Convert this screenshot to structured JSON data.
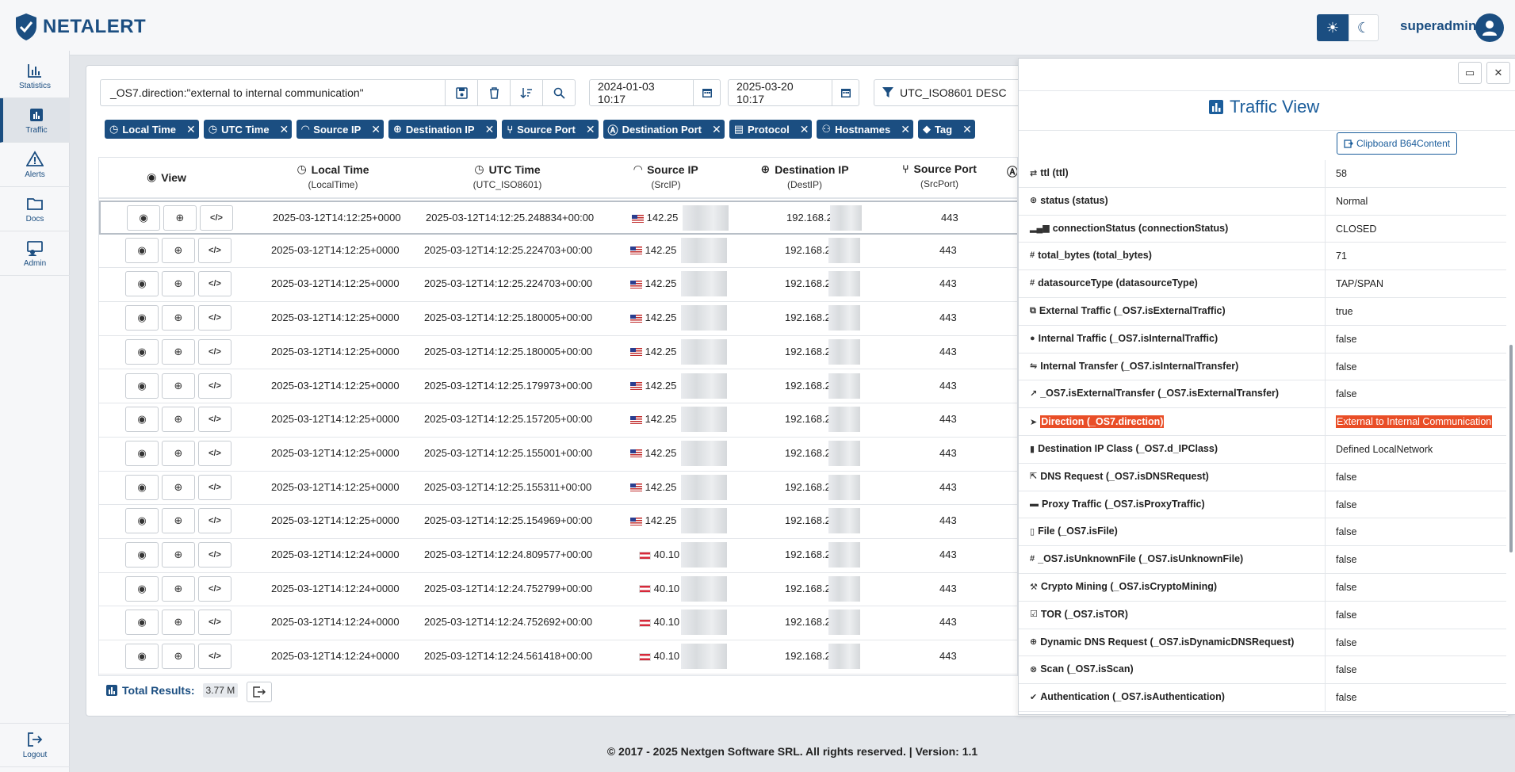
{
  "header": {
    "logo_text": "NETALERT",
    "username": "superadmin"
  },
  "sidebar": {
    "items": [
      {
        "label": "Statistics",
        "icon": "chart-icon"
      },
      {
        "label": "Traffic",
        "icon": "traffic-chart-icon"
      },
      {
        "label": "Alerts",
        "icon": "warning-icon"
      },
      {
        "label": "Docs",
        "icon": "folder-icon"
      },
      {
        "label": "Admin",
        "icon": "admin-icon"
      }
    ],
    "logout_label": "Logout"
  },
  "toolbar": {
    "query": "_OS7.direction:\"external to internal communication\"",
    "date_from": "2024-01-03 10:17",
    "date_to": "2025-03-20 10:17",
    "sort": "UTC_ISO8601 DESC"
  },
  "chips": [
    "Local Time",
    "UTC Time",
    "Source IP",
    "Destination IP",
    "Source Port",
    "Destination Port",
    "Protocol",
    "Hostnames",
    "Tag"
  ],
  "table": {
    "columns": [
      {
        "title": "View",
        "sub": ""
      },
      {
        "title": "Local Time",
        "sub": "(LocalTime)"
      },
      {
        "title": "UTC Time",
        "sub": "(UTC_ISO8601)"
      },
      {
        "title": "Source IP",
        "sub": "(SrcIP)"
      },
      {
        "title": "Destination IP",
        "sub": "(DestIP)"
      },
      {
        "title": "Source Port",
        "sub": "(SrcPort)"
      }
    ],
    "rows": [
      {
        "local": "2025-03-12T14:12:25+0000",
        "utc": "2025-03-12T14:12:25.248834+00:00",
        "flag": "us",
        "src": "142.25",
        "dst": "192.168.2",
        "port": "443"
      },
      {
        "local": "2025-03-12T14:12:25+0000",
        "utc": "2025-03-12T14:12:25.224703+00:00",
        "flag": "us",
        "src": "142.25",
        "dst": "192.168.2",
        "port": "443"
      },
      {
        "local": "2025-03-12T14:12:25+0000",
        "utc": "2025-03-12T14:12:25.224703+00:00",
        "flag": "us",
        "src": "142.25",
        "dst": "192.168.2",
        "port": "443"
      },
      {
        "local": "2025-03-12T14:12:25+0000",
        "utc": "2025-03-12T14:12:25.180005+00:00",
        "flag": "us",
        "src": "142.25",
        "dst": "192.168.2",
        "port": "443"
      },
      {
        "local": "2025-03-12T14:12:25+0000",
        "utc": "2025-03-12T14:12:25.180005+00:00",
        "flag": "us",
        "src": "142.25",
        "dst": "192.168.2",
        "port": "443"
      },
      {
        "local": "2025-03-12T14:12:25+0000",
        "utc": "2025-03-12T14:12:25.179973+00:00",
        "flag": "us",
        "src": "142.25",
        "dst": "192.168.2",
        "port": "443"
      },
      {
        "local": "2025-03-12T14:12:25+0000",
        "utc": "2025-03-12T14:12:25.157205+00:00",
        "flag": "us",
        "src": "142.25",
        "dst": "192.168.2",
        "port": "443"
      },
      {
        "local": "2025-03-12T14:12:25+0000",
        "utc": "2025-03-12T14:12:25.155001+00:00",
        "flag": "us",
        "src": "142.25",
        "dst": "192.168.2",
        "port": "443"
      },
      {
        "local": "2025-03-12T14:12:25+0000",
        "utc": "2025-03-12T14:12:25.155311+00:00",
        "flag": "us",
        "src": "142.25",
        "dst": "192.168.2",
        "port": "443"
      },
      {
        "local": "2025-03-12T14:12:25+0000",
        "utc": "2025-03-12T14:12:25.154969+00:00",
        "flag": "us",
        "src": "142.25",
        "dst": "192.168.2",
        "port": "443"
      },
      {
        "local": "2025-03-12T14:12:24+0000",
        "utc": "2025-03-12T14:12:24.809577+00:00",
        "flag": "at",
        "src": "40.10",
        "dst": "192.168.2",
        "port": "443"
      },
      {
        "local": "2025-03-12T14:12:24+0000",
        "utc": "2025-03-12T14:12:24.752799+00:00",
        "flag": "at",
        "src": "40.10",
        "dst": "192.168.2",
        "port": "443"
      },
      {
        "local": "2025-03-12T14:12:24+0000",
        "utc": "2025-03-12T14:12:24.752692+00:00",
        "flag": "at",
        "src": "40.10",
        "dst": "192.168.2",
        "port": "443"
      },
      {
        "local": "2025-03-12T14:12:24+0000",
        "utc": "2025-03-12T14:12:24.561418+00:00",
        "flag": "at",
        "src": "40.10",
        "dst": "192.168.2",
        "port": "443"
      }
    ]
  },
  "total": {
    "label": "Total Results:",
    "value": "3.77 M"
  },
  "panel": {
    "title": "Traffic View",
    "clipboard_label": "Clipboard B64Content",
    "rows": [
      {
        "key": "ttl (ttl)",
        "val": "58",
        "icon": "arrows-icon"
      },
      {
        "key": "status (status)",
        "val": "Normal",
        "icon": "status-icon"
      },
      {
        "key": "connectionStatus (connectionStatus)",
        "val": "CLOSED",
        "icon": "signal-icon"
      },
      {
        "key": "total_bytes (total_bytes)",
        "val": "71",
        "icon": "hash-icon"
      },
      {
        "key": "datasourceType (datasourceType)",
        "val": "TAP/SPAN",
        "icon": "hash-icon"
      },
      {
        "key": "External Traffic (_OS7.isExternalTraffic)",
        "val": "true",
        "icon": "external-icon"
      },
      {
        "key": "Internal Traffic (_OS7.isInternalTraffic)",
        "val": "false",
        "icon": "internal-icon"
      },
      {
        "key": "Internal Transfer (_OS7.isInternalTransfer)",
        "val": "false",
        "icon": "transfer-icon"
      },
      {
        "key": "_OS7.isExternalTransfer (_OS7.isExternalTransfer)",
        "val": "false",
        "icon": "link-out-icon"
      },
      {
        "key": "Direction (_OS7.direction)",
        "val": "External to Internal Communication",
        "icon": "direction-icon",
        "highlight": true
      },
      {
        "key": "Destination IP Class (_OS7.d_IPClass)",
        "val": "Defined LocalNetwork",
        "icon": "book-icon"
      },
      {
        "key": "DNS Request (_OS7.isDNSRequest)",
        "val": "false",
        "icon": "dns-icon"
      },
      {
        "key": "Proxy Traffic (_OS7.isProxyTraffic)",
        "val": "false",
        "icon": "server-icon"
      },
      {
        "key": "File (_OS7.isFile)",
        "val": "false",
        "icon": "file-icon"
      },
      {
        "key": "_OS7.isUnknownFile (_OS7.isUnknownFile)",
        "val": "false",
        "icon": "hash-icon"
      },
      {
        "key": "Crypto Mining (_OS7.isCryptoMining)",
        "val": "false",
        "icon": "mining-icon"
      },
      {
        "key": "TOR (_OS7.isTOR)",
        "val": "false",
        "icon": "tor-icon"
      },
      {
        "key": "Dynamic DNS Request (_OS7.isDynamicDNSRequest)",
        "val": "false",
        "icon": "globe-icon"
      },
      {
        "key": "Scan (_OS7.isScan)",
        "val": "false",
        "icon": "scan-icon"
      },
      {
        "key": "Authentication (_OS7.isAuthentication)",
        "val": "false",
        "icon": "check-icon"
      }
    ]
  },
  "footer": "© 2017 - 2025 Nextgen Software SRL. All rights reserved. | Version: 1.1",
  "colors": {
    "brand": "#1b4e81",
    "highlight": "#e94e27",
    "panel_title": "#1b5d9b"
  }
}
